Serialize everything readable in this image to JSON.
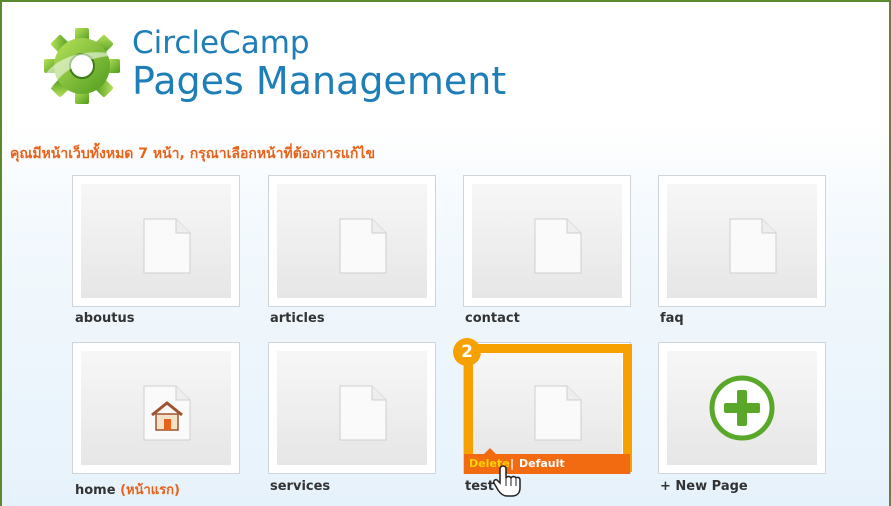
{
  "header": {
    "title_line1": "CircleCamp",
    "title_line2": "Pages Management"
  },
  "headline": "คุณมีหน้าเว็บทั้งหมด 7 หน้า, กรุณาเลือกหน้าที่ต้องการแก้ไข",
  "pages": [
    {
      "name": "aboutus"
    },
    {
      "name": "articles"
    },
    {
      "name": "contact"
    },
    {
      "name": "faq"
    },
    {
      "name": "home",
      "suffix": "(หน้าแรก)"
    },
    {
      "name": "services"
    },
    {
      "name": "test"
    }
  ],
  "new_page_label": "+ New Page",
  "actions": {
    "delete": "Delete",
    "separator": "|",
    "default": "Default"
  },
  "step_badge": "2",
  "colors": {
    "title_blue": "#1e7fb8",
    "accent_orange": "#e8621a",
    "highlight_orange": "#f7a100",
    "plus_green": "#5aa82a",
    "frame_green": "#5b8a2d"
  }
}
